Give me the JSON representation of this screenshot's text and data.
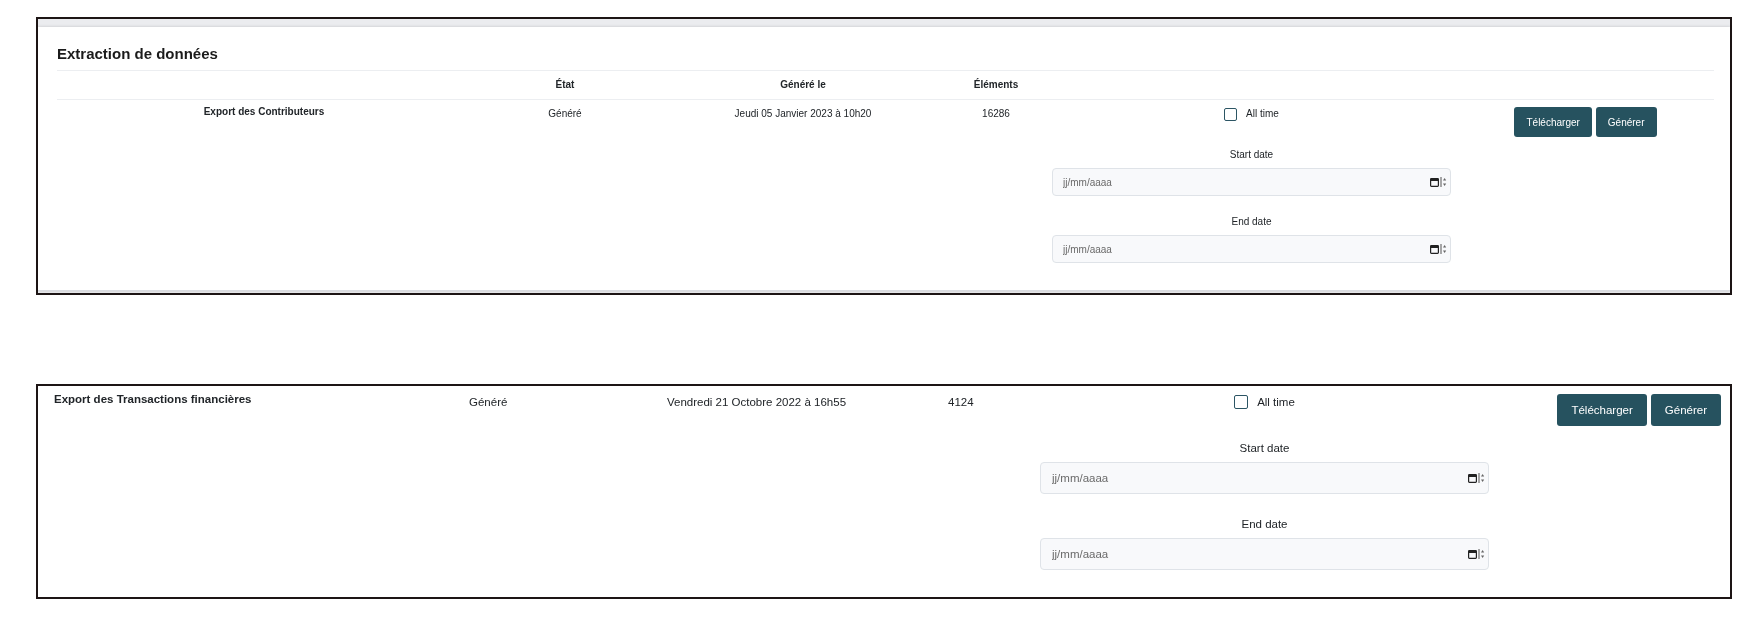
{
  "panels": [
    {
      "kind": "card",
      "title": "Extraction de données",
      "columns": [
        "État",
        "Généré le",
        "Éléments"
      ],
      "rows": [
        {
          "name": "Export des Contributeurs",
          "state": "Généré",
          "generated_on": "Jeudi 05 Janvier 2023 à 10h20",
          "elements": "16286",
          "all_time": {
            "label": "All time",
            "checked": false
          },
          "dates": [
            {
              "label": "Start date",
              "placeholder": "jj/mm/aaaa"
            },
            {
              "label": "End date",
              "placeholder": "jj/mm/aaaa"
            }
          ],
          "buttons": [
            "Télécharger",
            "Générer"
          ]
        }
      ]
    },
    {
      "kind": "plain",
      "rows": [
        {
          "name": "Export des Transactions financières",
          "state": "Généré",
          "generated_on": "Vendredi 21 Octobre 2022 à 16h55",
          "elements": "4124",
          "all_time": {
            "label": "All time",
            "checked": false
          },
          "dates": [
            {
              "label": "Start date",
              "placeholder": "jj/mm/aaaa"
            },
            {
              "label": "End date",
              "placeholder": "jj/mm/aaaa"
            }
          ],
          "buttons": [
            "Télécharger",
            "Générer"
          ]
        }
      ]
    }
  ]
}
